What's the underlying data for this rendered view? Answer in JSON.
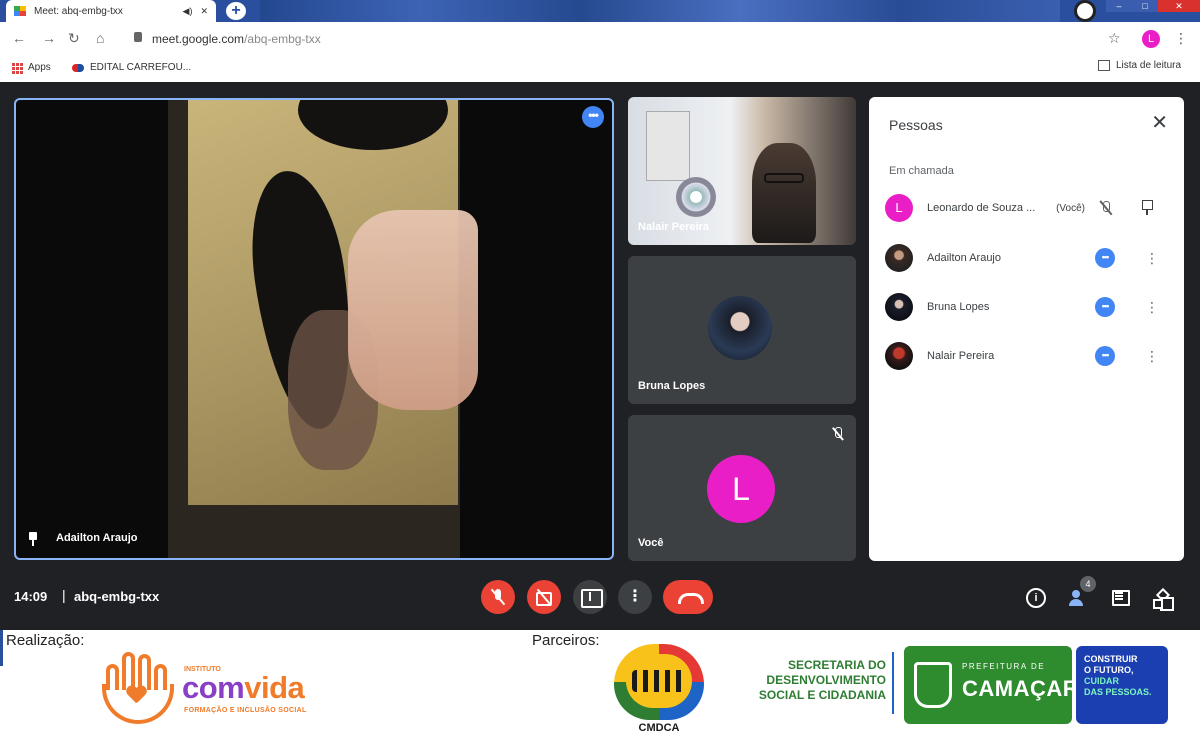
{
  "browser": {
    "tab_title": "Meet: abq-embg-txx",
    "new_tab_symbol": "+",
    "url_host": "meet.google.com",
    "url_path": "/abq-embg-txx",
    "profile_initial": "L",
    "bookmarks": [
      {
        "label": "Apps"
      },
      {
        "label": "EDITAL CARREFOU..."
      }
    ],
    "reading_list": "Lista de leitura",
    "window_controls": [
      "–",
      "□",
      "✕"
    ]
  },
  "meet": {
    "main_tile": {
      "name": "Adailton Araujo"
    },
    "side_tiles": [
      {
        "name": "Nalair Pereira"
      },
      {
        "name": "Bruna Lopes"
      },
      {
        "name": "Você",
        "initial": "L",
        "color": "#e91ec6"
      }
    ],
    "people_panel": {
      "title": "Pessoas",
      "section": "Em chamada",
      "participants": [
        {
          "name": "Leonardo de Souza ...",
          "you_label": "(Você)",
          "initial": "L",
          "color": "#e91ec6"
        },
        {
          "name": "Adailton Araujo"
        },
        {
          "name": "Bruna Lopes"
        },
        {
          "name": "Nalair Pereira"
        }
      ]
    },
    "controls": {
      "time": "14:09",
      "separator": "|",
      "meeting_code": "abq-embg-txx",
      "people_count": "4",
      "info_glyph": "i",
      "more_glyph": "⋮"
    }
  },
  "footer": {
    "realizacao_label": "Realização:",
    "parceiros_label": "Parceiros:",
    "comvida": {
      "top": "INSTITUTO",
      "brand_a": "com",
      "brand_b": "vida",
      "sub": "FORMAÇÃO E INCLUSÃO SOCIAL"
    },
    "cmdca": "CMDCA",
    "secretaria": [
      "SECRETARIA DO",
      "DESENVOLVIMENTO",
      "SOCIAL E CIDADANIA"
    ],
    "camacari": {
      "prefeitura": "PREFEITURA DE",
      "name": "CAMAÇARI"
    },
    "slogan": [
      "CONSTRUIR",
      "O FUTURO,",
      "CUIDAR",
      "DAS PESSOAS."
    ]
  },
  "colors": {
    "meet_bg": "#202124",
    "tile_bg": "#3c4043",
    "active_border": "#8ab4f8",
    "danger_red": "#ea4335",
    "accent_blue": "#4285f4",
    "avatar_pink": "#e91ec6"
  }
}
